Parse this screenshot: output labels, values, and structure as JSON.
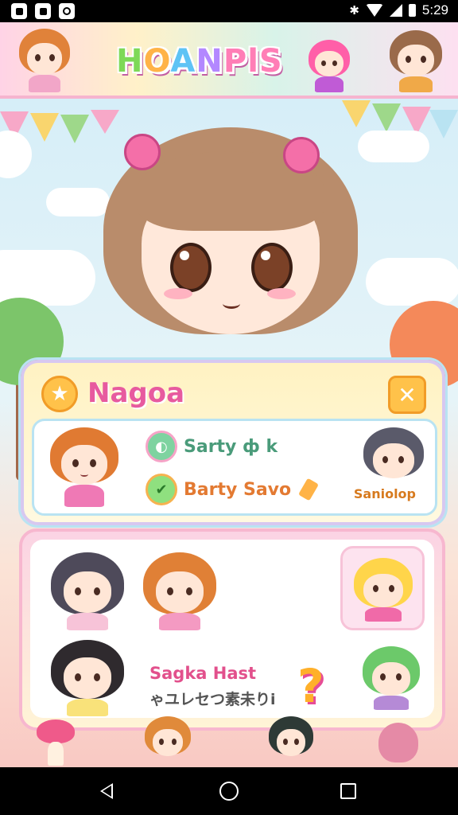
{
  "status_bar": {
    "time": "5:29",
    "left_icons": [
      "notification-icon",
      "notification-icon",
      "record-icon"
    ],
    "right_icons": [
      "bluetooth-icon",
      "wifi-icon",
      "signal-icon",
      "battery-icon"
    ]
  },
  "header": {
    "logo_text": "HOANPlS",
    "logo_letters": [
      "H",
      "O",
      "A",
      "N",
      "Pl",
      "S"
    ]
  },
  "profile_panel": {
    "title": "Nagoa",
    "star_icon": "star-icon",
    "close_icon": "close-icon",
    "options": [
      {
        "label": "Sarty ф k",
        "icon": "palette-icon"
      },
      {
        "label": "Barty Savo",
        "icon": "check-icon"
      }
    ],
    "side_label": "Saniolop"
  },
  "character_panel": {
    "caption": "Sagka Hast",
    "subcaption": "ゃユレセつ素未りi",
    "help_icon": "question-icon"
  },
  "navbar": {
    "back_icon": "back-icon",
    "home_icon": "home-icon",
    "recent_icon": "recents-icon"
  },
  "colors": {
    "accent_pink": "#e75a9f",
    "accent_yellow": "#ffc24a",
    "accent_green": "#4a9b7a",
    "accent_orange": "#e37a32"
  }
}
